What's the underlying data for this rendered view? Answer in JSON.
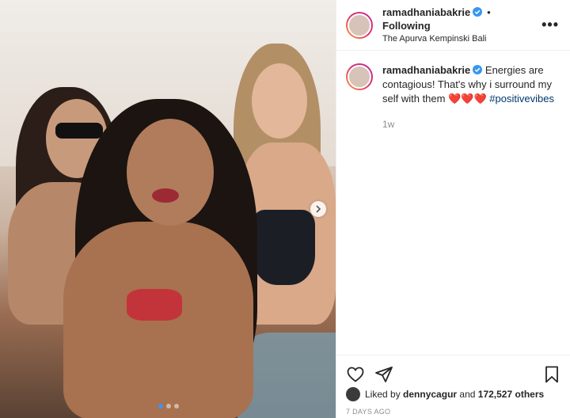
{
  "post": {
    "username": "ramadhaniabakrie",
    "separator": "•",
    "follow_status": "Following",
    "location": "The Apurva Kempinski Bali",
    "more_label": "•••"
  },
  "caption": {
    "username": "ramadhaniabakrie",
    "text": "Energies are contagious! That's why i surround my self with them",
    "hearts": "❤️❤️❤️",
    "hashtag": "#positivevibes",
    "time": "1w"
  },
  "likes": {
    "prefix": "Liked by",
    "user": "dennycagur",
    "joiner": "and",
    "count": "172,527 others"
  },
  "timestamp": "7 DAYS AGO",
  "carousel": {
    "dots": 3,
    "active_index": 0
  },
  "colors": {
    "verified": "#3897f0",
    "hashtag": "#00376b",
    "muted": "#8e8e8e"
  },
  "icons": {
    "like": "heart-icon",
    "share": "send-icon",
    "save": "bookmark-icon",
    "verified": "verified-badge-icon",
    "next": "chevron-right-icon"
  }
}
